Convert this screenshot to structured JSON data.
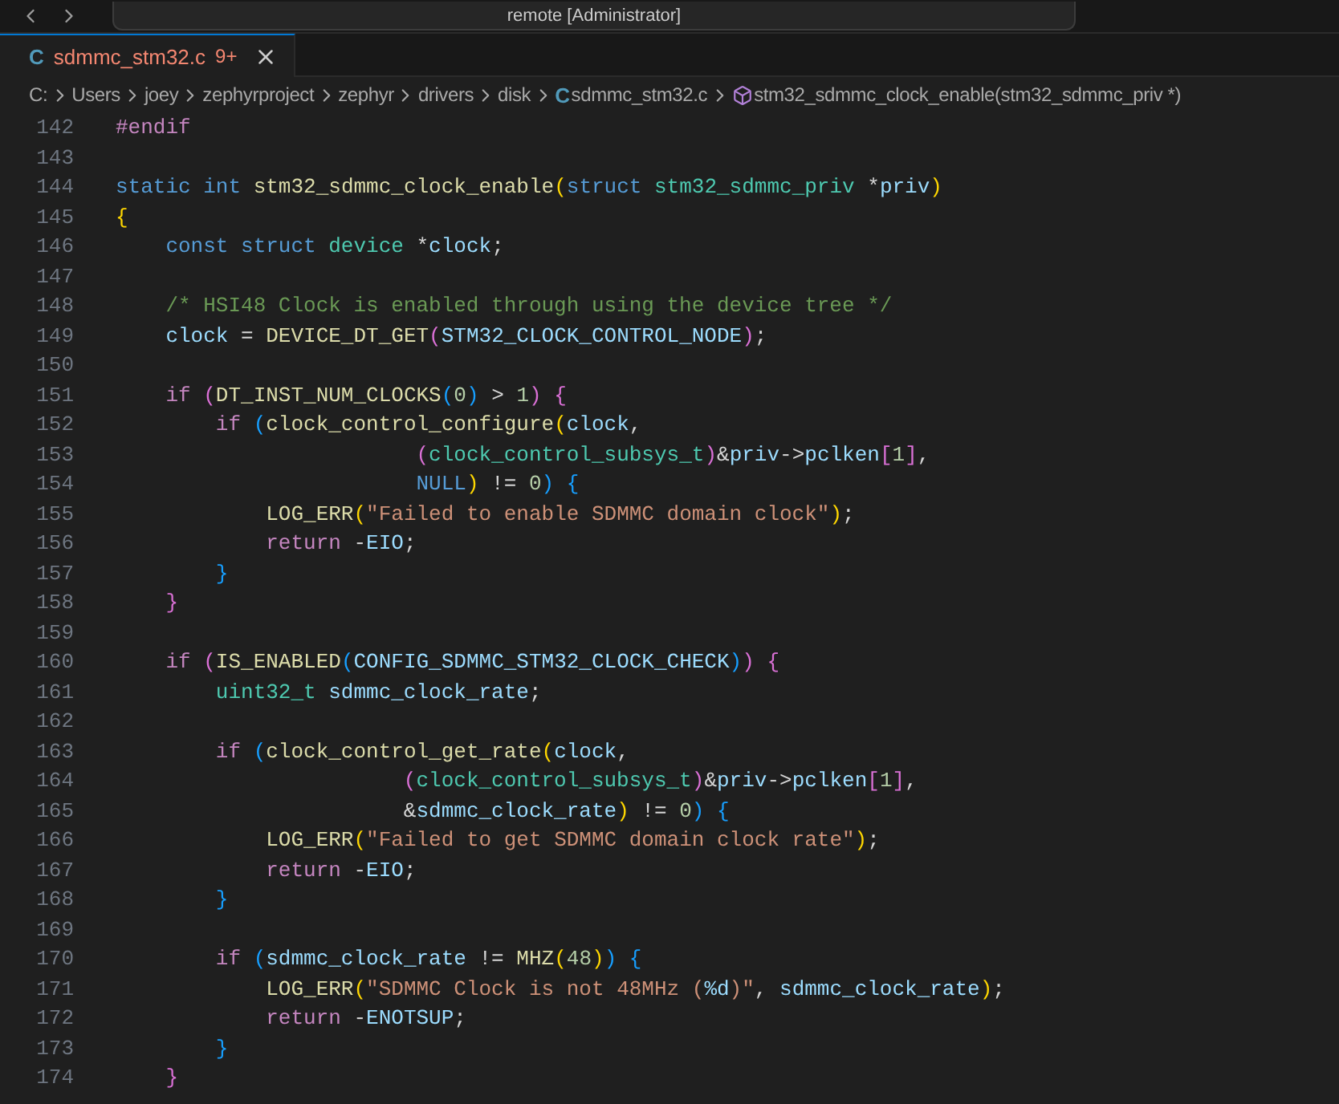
{
  "title_bar": {
    "title": "remote [Administrator]"
  },
  "tabs": [
    {
      "icon": "C",
      "label": "sdmmc_stm32.c",
      "badge": "9+",
      "selected": true
    }
  ],
  "breadcrumbs": [
    {
      "kind": "folder",
      "text": "C:"
    },
    {
      "kind": "folder",
      "text": "Users"
    },
    {
      "kind": "folder",
      "text": "joey"
    },
    {
      "kind": "folder",
      "text": "zephyrproject"
    },
    {
      "kind": "folder",
      "text": "zephyr"
    },
    {
      "kind": "folder",
      "text": "drivers"
    },
    {
      "kind": "folder",
      "text": "disk"
    },
    {
      "kind": "file",
      "icon": "C",
      "text": "sdmmc_stm32.c"
    },
    {
      "kind": "symbol",
      "text": "stm32_sdmmc_clock_enable(stm32_sdmmc_priv *)"
    }
  ],
  "editor": {
    "lines": [
      {
        "number": "142",
        "tokens": [
          {
            "kind": "ctl",
            "text": "#endif"
          }
        ]
      },
      {
        "number": "143"
      },
      {
        "number": "144",
        "tokens": [
          {
            "kind": "kw",
            "text": "static"
          },
          {
            "kind": "kw",
            "text": " int"
          },
          {
            "kind": "fn",
            "text": " stm32_sdmmc_clock_enable"
          },
          {
            "kind": "b1",
            "text": "("
          },
          {
            "kind": "kw",
            "text": "struct"
          },
          {
            "kind": "type",
            "text": " stm32_sdmmc_priv"
          },
          {
            "kind": "plain",
            "text": " *"
          },
          {
            "kind": "var",
            "text": "priv"
          },
          {
            "kind": "b1",
            "text": ")"
          }
        ]
      },
      {
        "number": "145",
        "tokens": [
          {
            "kind": "b1",
            "text": "{"
          }
        ]
      },
      {
        "number": "146",
        "tokens": [
          {
            "kind": "kw",
            "text": "    const"
          },
          {
            "kind": "kw",
            "text": " struct"
          },
          {
            "kind": "type",
            "text": " device"
          },
          {
            "kind": "plain",
            "text": " *"
          },
          {
            "kind": "var",
            "text": "clock"
          },
          {
            "kind": "plain",
            "text": ";"
          }
        ]
      },
      {
        "number": "147"
      },
      {
        "number": "148",
        "tokens": [
          {
            "kind": "comment",
            "text": "    /* HSI48 Clock is enabled through using the device tree */"
          }
        ]
      },
      {
        "number": "149",
        "tokens": [
          {
            "kind": "var",
            "text": "    clock"
          },
          {
            "kind": "plain",
            "text": " ="
          },
          {
            "kind": "fn",
            "text": " DEVICE_DT_GET"
          },
          {
            "kind": "b2",
            "text": "("
          },
          {
            "kind": "var",
            "text": "STM32_CLOCK_CONTROL_NODE"
          },
          {
            "kind": "b2",
            "text": ")"
          },
          {
            "kind": "plain",
            "text": ";"
          }
        ]
      },
      {
        "number": "150"
      },
      {
        "number": "151",
        "tokens": [
          {
            "kind": "ctl",
            "text": "    if"
          },
          {
            "kind": "b2",
            "text": " ("
          },
          {
            "kind": "fn",
            "text": "DT_INST_NUM_CLOCKS"
          },
          {
            "kind": "b3",
            "text": "("
          },
          {
            "kind": "num",
            "text": "0"
          },
          {
            "kind": "b3",
            "text": ")"
          },
          {
            "kind": "plain",
            "text": " >"
          },
          {
            "kind": "num",
            "text": " 1"
          },
          {
            "kind": "b2",
            "text": ")"
          },
          {
            "kind": "b2",
            "text": " {"
          }
        ]
      },
      {
        "number": "152",
        "tokens": [
          {
            "kind": "ctl",
            "text": "        if"
          },
          {
            "kind": "b3",
            "text": " ("
          },
          {
            "kind": "fn",
            "text": "clock_control_configure"
          },
          {
            "kind": "b1",
            "text": "("
          },
          {
            "kind": "var",
            "text": "clock"
          },
          {
            "kind": "plain",
            "text": ","
          }
        ]
      },
      {
        "number": "153",
        "tokens": [
          {
            "kind": "b2",
            "text": "                        ("
          },
          {
            "kind": "type",
            "text": "clock_control_subsys_t"
          },
          {
            "kind": "b2",
            "text": ")"
          },
          {
            "kind": "plain",
            "text": "&"
          },
          {
            "kind": "var",
            "text": "priv"
          },
          {
            "kind": "plain",
            "text": "->"
          },
          {
            "kind": "var",
            "text": "pclken"
          },
          {
            "kind": "b2",
            "text": "["
          },
          {
            "kind": "num",
            "text": "1"
          },
          {
            "kind": "b2",
            "text": "]"
          },
          {
            "kind": "plain",
            "text": ","
          }
        ]
      },
      {
        "number": "154",
        "tokens": [
          {
            "kind": "kw",
            "text": "                        NULL"
          },
          {
            "kind": "b1",
            "text": ")"
          },
          {
            "kind": "plain",
            "text": " !="
          },
          {
            "kind": "num",
            "text": " 0"
          },
          {
            "kind": "b3",
            "text": ")"
          },
          {
            "kind": "b3",
            "text": " {"
          }
        ]
      },
      {
        "number": "155",
        "tokens": [
          {
            "kind": "fn",
            "text": "            LOG_ERR"
          },
          {
            "kind": "b1",
            "text": "("
          },
          {
            "kind": "str",
            "text": "\"Failed to enable SDMMC domain clock\""
          },
          {
            "kind": "b1",
            "text": ")"
          },
          {
            "kind": "plain",
            "text": ";"
          }
        ]
      },
      {
        "number": "156",
        "tokens": [
          {
            "kind": "ctl",
            "text": "            return"
          },
          {
            "kind": "plain",
            "text": " -"
          },
          {
            "kind": "var",
            "text": "EIO"
          },
          {
            "kind": "plain",
            "text": ";"
          }
        ]
      },
      {
        "number": "157",
        "tokens": [
          {
            "kind": "b3",
            "text": "        }"
          }
        ]
      },
      {
        "number": "158",
        "tokens": [
          {
            "kind": "b2",
            "text": "    }"
          }
        ]
      },
      {
        "number": "159"
      },
      {
        "number": "160",
        "tokens": [
          {
            "kind": "ctl",
            "text": "    if"
          },
          {
            "kind": "b2",
            "text": " ("
          },
          {
            "kind": "fn",
            "text": "IS_ENABLED"
          },
          {
            "kind": "b3",
            "text": "("
          },
          {
            "kind": "var",
            "text": "CONFIG_SDMMC_STM32_CLOCK_CHECK"
          },
          {
            "kind": "b3",
            "text": ")"
          },
          {
            "kind": "b2",
            "text": ")"
          },
          {
            "kind": "b2",
            "text": " {"
          }
        ]
      },
      {
        "number": "161",
        "tokens": [
          {
            "kind": "type",
            "text": "        uint32_t"
          },
          {
            "kind": "var",
            "text": " sdmmc_clock_rate"
          },
          {
            "kind": "plain",
            "text": ";"
          }
        ]
      },
      {
        "number": "162"
      },
      {
        "number": "163",
        "tokens": [
          {
            "kind": "ctl",
            "text": "        if"
          },
          {
            "kind": "b3",
            "text": " ("
          },
          {
            "kind": "fn",
            "text": "clock_control_get_rate"
          },
          {
            "kind": "b1",
            "text": "("
          },
          {
            "kind": "var",
            "text": "clock"
          },
          {
            "kind": "plain",
            "text": ","
          }
        ]
      },
      {
        "number": "164",
        "tokens": [
          {
            "kind": "b2",
            "text": "                       ("
          },
          {
            "kind": "type",
            "text": "clock_control_subsys_t"
          },
          {
            "kind": "b2",
            "text": ")"
          },
          {
            "kind": "plain",
            "text": "&"
          },
          {
            "kind": "var",
            "text": "priv"
          },
          {
            "kind": "plain",
            "text": "->"
          },
          {
            "kind": "var",
            "text": "pclken"
          },
          {
            "kind": "b2",
            "text": "["
          },
          {
            "kind": "num",
            "text": "1"
          },
          {
            "kind": "b2",
            "text": "]"
          },
          {
            "kind": "plain",
            "text": ","
          }
        ]
      },
      {
        "number": "165",
        "tokens": [
          {
            "kind": "plain",
            "text": "                       &"
          },
          {
            "kind": "var",
            "text": "sdmmc_clock_rate"
          },
          {
            "kind": "b1",
            "text": ")"
          },
          {
            "kind": "plain",
            "text": " !="
          },
          {
            "kind": "num",
            "text": " 0"
          },
          {
            "kind": "b3",
            "text": ")"
          },
          {
            "kind": "b3",
            "text": " {"
          }
        ]
      },
      {
        "number": "166",
        "tokens": [
          {
            "kind": "fn",
            "text": "            LOG_ERR"
          },
          {
            "kind": "b1",
            "text": "("
          },
          {
            "kind": "str",
            "text": "\"Failed to get SDMMC domain clock rate\""
          },
          {
            "kind": "b1",
            "text": ")"
          },
          {
            "kind": "plain",
            "text": ";"
          }
        ]
      },
      {
        "number": "167",
        "tokens": [
          {
            "kind": "ctl",
            "text": "            return"
          },
          {
            "kind": "plain",
            "text": " -"
          },
          {
            "kind": "var",
            "text": "EIO"
          },
          {
            "kind": "plain",
            "text": ";"
          }
        ]
      },
      {
        "number": "168",
        "tokens": [
          {
            "kind": "b3",
            "text": "        }"
          }
        ]
      },
      {
        "number": "169"
      },
      {
        "number": "170",
        "tokens": [
          {
            "kind": "ctl",
            "text": "        if"
          },
          {
            "kind": "b3",
            "text": " ("
          },
          {
            "kind": "var",
            "text": "sdmmc_clock_rate"
          },
          {
            "kind": "plain",
            "text": " !="
          },
          {
            "kind": "fn",
            "text": " MHZ"
          },
          {
            "kind": "b1",
            "text": "("
          },
          {
            "kind": "num",
            "text": "48"
          },
          {
            "kind": "b1",
            "text": ")"
          },
          {
            "kind": "b3",
            "text": ")"
          },
          {
            "kind": "b3",
            "text": " {"
          }
        ]
      },
      {
        "number": "171",
        "tokens": [
          {
            "kind": "fn",
            "text": "            LOG_ERR"
          },
          {
            "kind": "b1",
            "text": "("
          },
          {
            "kind": "str",
            "text": "\"SDMMC Clock is not 48MHz ("
          },
          {
            "kind": "var",
            "text": "%d"
          },
          {
            "kind": "str",
            "text": ")\""
          },
          {
            "kind": "plain",
            "text": ","
          },
          {
            "kind": "var",
            "text": " sdmmc_clock_rate"
          },
          {
            "kind": "b1",
            "text": ")"
          },
          {
            "kind": "plain",
            "text": ";"
          }
        ]
      },
      {
        "number": "172",
        "tokens": [
          {
            "kind": "ctl",
            "text": "            return"
          },
          {
            "kind": "plain",
            "text": " -"
          },
          {
            "kind": "var",
            "text": "ENOTSUP"
          },
          {
            "kind": "plain",
            "text": ";"
          }
        ]
      },
      {
        "number": "173",
        "tokens": [
          {
            "kind": "b3",
            "text": "        }"
          }
        ]
      },
      {
        "number": "174",
        "tokens": [
          {
            "kind": "b2",
            "text": "    }"
          }
        ]
      }
    ]
  }
}
